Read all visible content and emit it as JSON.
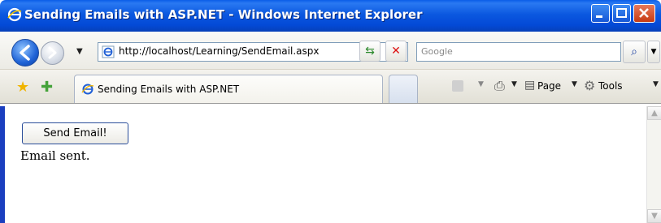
{
  "window": {
    "title": "Sending Emails with ASP.NET - Windows Internet Explorer"
  },
  "navbar": {
    "url": "http://localhost/Learning/SendEmail.aspx",
    "search_placeholder": "Google"
  },
  "tabs": [
    {
      "label": "Sending Emails with ASP.NET",
      "active": true
    }
  ],
  "commandbar": {
    "page_label": "Page",
    "tools_label": "Tools"
  },
  "page": {
    "send_button_label": "Send Email!",
    "status_text": "Email sent."
  }
}
